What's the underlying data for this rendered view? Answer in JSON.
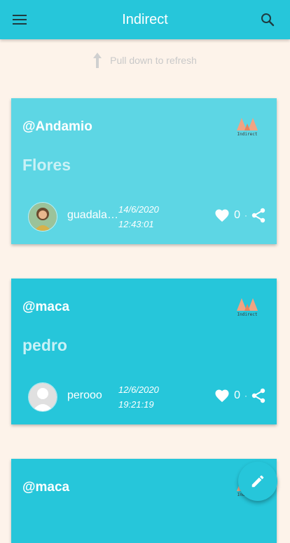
{
  "appbar": {
    "title": "Indirect"
  },
  "refresh": {
    "label": "Pull down to refresh"
  },
  "posts": [
    {
      "handle": "@Andamio",
      "title": "Flores",
      "user": "guadalajara",
      "date": "14/6/2020",
      "time": "12:43:01",
      "likes": "0",
      "brand": "Indirect"
    },
    {
      "handle": "@maca",
      "title": "pedro",
      "user": "perooo",
      "date": "12/6/2020",
      "time": "19:21:19",
      "likes": "0",
      "brand": "Indirect"
    },
    {
      "handle": "@maca",
      "brand": "Indirect"
    }
  ],
  "colors": {
    "primary": "#26c6da",
    "card_light": "#5dd6e4",
    "background": "#fdf3ea"
  }
}
